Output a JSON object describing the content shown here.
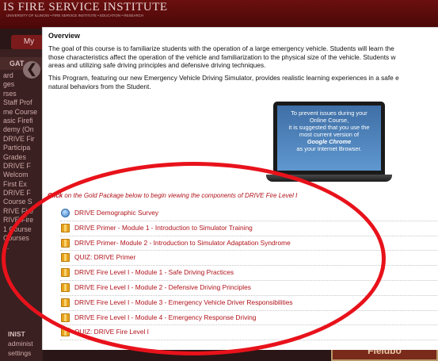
{
  "background": {
    "site_title": "IS FIRE SERVICE INSTITUTE",
    "site_tagline": "UNIVERSITY OF ILLINOIS • FIRE SERVICE INSTITUTE • EDUCATION • RESEARCH",
    "my_button": "My",
    "sidebar_heading": "GAT",
    "sidebar_items": [
      "ard",
      "ges",
      "rses",
      "Staff Prof",
      "me Course",
      "asic Firefi",
      "demy (On",
      "DRIVE Fir",
      "Participa",
      "Grades",
      "DRIVE F",
      "Welcom",
      "First Ex",
      "DRIVE F",
      "Course S",
      "RIVE Fire",
      "RIVE Fire",
      "1 Course",
      "Courses",
      "...",
      ""
    ],
    "admin_heading": "INIST",
    "admin_items": [
      "administ",
      "settings"
    ],
    "promo_label": "Fieldbo"
  },
  "modal": {
    "overview_title": "Overview",
    "paragraph_lines": [
      "The goal of this course is to familiarize students with the operation of a large emergency vehicle.  Students will learn the",
      "those characteristics affect the operation of the vehicle and familiarization to the physical size of the vehicle.  Students w",
      "areas and utilizing safe driving principles and defensive driving techniques.",
      "This Program, featuring our new Emergency Vehicle Driving Simulator, provides realistic learning experiences in a safe e",
      "natural behaviors from the Student."
    ],
    "laptop_message": {
      "line1": "To prevent issues during your",
      "line2": "Online Course,",
      "line3": "it is suggested that you use the",
      "line4": "most current version of",
      "line5": "Google Chrome",
      "line6": "as your Internet Browser."
    },
    "click_prefix": "Click",
    "click_text": " on the Gold Package below to begin viewing the components of DRIVE Fire Level I",
    "items": [
      {
        "label": "DRIVE Demographic Survey",
        "icon": "survey-icon"
      },
      {
        "label": "DRIVE Primer - Module 1 - Introduction to Simulator Training",
        "icon": "gold-package-icon"
      },
      {
        "label": "DRIVE Primer- Module 2 - Introduction to Simulator Adaptation Syndrome",
        "icon": "gold-package-icon"
      },
      {
        "label": "QUIZ: DRIVE Primer",
        "icon": "gold-package-icon"
      },
      {
        "label": "DRIVE Fire Level I - Module 1 - Safe Driving Practices",
        "icon": "gold-package-icon"
      },
      {
        "label": "DRIVE Fire Level I - Module 2 - Defensive Driving Principles",
        "icon": "gold-package-icon"
      },
      {
        "label": "DRIVE Fire Level I - Module 3 - Emergency Vehicle Driver Responsibilities",
        "icon": "gold-package-icon"
      },
      {
        "label": "DRIVE Fire Level I - Module 4 - Emergency Response Driving",
        "icon": "gold-package-icon"
      },
      {
        "label": "QUIZ: DRIVE Fire Level I",
        "icon": "gold-package-icon"
      }
    ]
  },
  "colors": {
    "accent_red": "#b0131b",
    "annotation_red": "#e8121b",
    "package_gold": "#e8a21e"
  }
}
